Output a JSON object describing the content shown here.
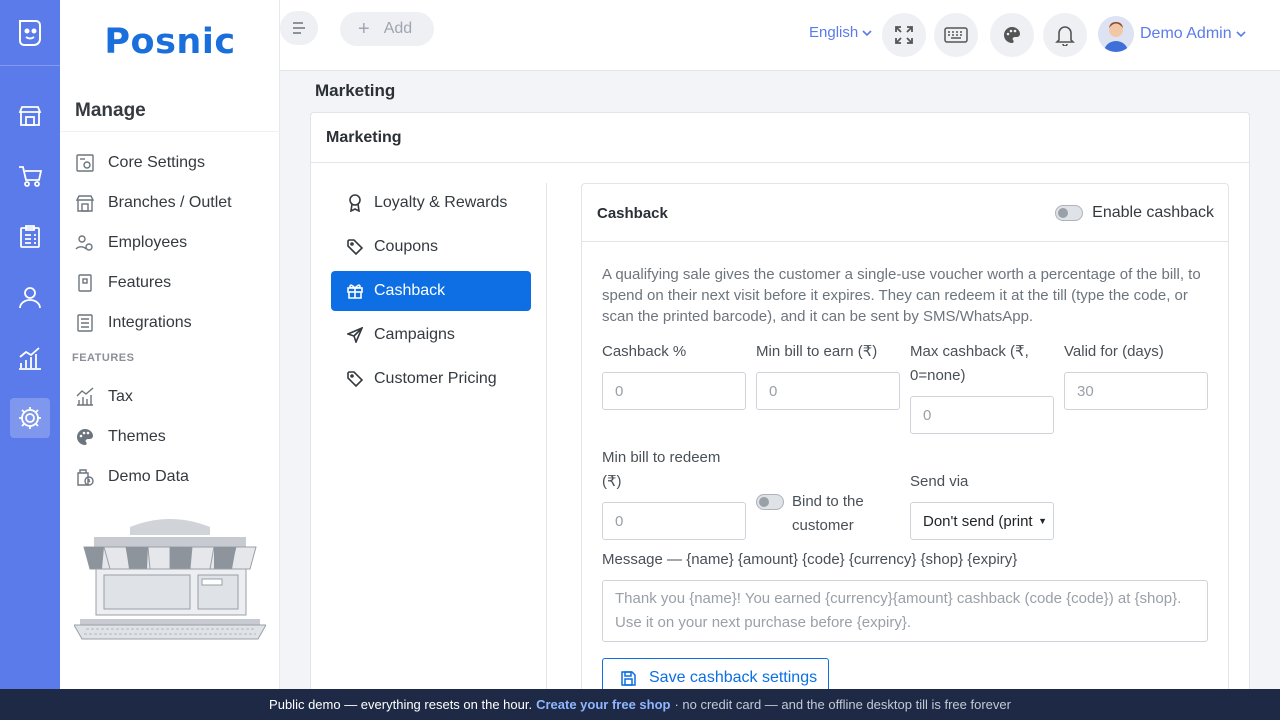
{
  "brand": {
    "name": "Posnic"
  },
  "menu": {
    "title": "Manage",
    "items": [
      {
        "label": "Core Settings",
        "icon": "settings-doc-icon"
      },
      {
        "label": "Branches / Outlet",
        "icon": "store-icon"
      },
      {
        "label": "Employees",
        "icon": "employees-gear-icon"
      },
      {
        "label": "Features",
        "icon": "features-icon"
      },
      {
        "label": "Integrations",
        "icon": "integrations-icon"
      }
    ],
    "section_label": "FEATURES",
    "feature_items": [
      {
        "label": "Tax",
        "icon": "tax-chart-icon"
      },
      {
        "label": "Themes",
        "icon": "palette-icon"
      },
      {
        "label": "Demo Data",
        "icon": "demo-data-icon"
      }
    ]
  },
  "topbar": {
    "add_label": "Add",
    "language": "English",
    "user_name": "Demo Admin"
  },
  "page": {
    "title": "Marketing"
  },
  "card": {
    "title": "Marketing"
  },
  "subnav": [
    {
      "label": "Loyalty & Rewards",
      "icon": "award-icon",
      "active": false
    },
    {
      "label": "Coupons",
      "icon": "tag-icon",
      "active": false
    },
    {
      "label": "Cashback",
      "icon": "gift-icon",
      "active": true
    },
    {
      "label": "Campaigns",
      "icon": "send-icon",
      "active": false
    },
    {
      "label": "Customer Pricing",
      "icon": "tag-icon",
      "active": false
    }
  ],
  "cashback": {
    "title": "Cashback",
    "enable_label": "Enable cashback",
    "description": "A qualifying sale gives the customer a single-use voucher worth a percentage of the bill, to spend on their next visit before it expires. They can redeem it at the till (type the code, or scan the printed barcode), and it can be sent by SMS/WhatsApp.",
    "fields": {
      "percent": {
        "label": "Cashback %",
        "placeholder": "0"
      },
      "min_bill_earn": {
        "label": "Min bill to earn (₹)",
        "placeholder": "0"
      },
      "max_cashback_line1": "Max cashback (₹,",
      "max_cashback_line2": "0=none)",
      "max_cashback_placeholder": "0",
      "valid_for": {
        "label": "Valid for (days)",
        "placeholder": "30"
      },
      "min_bill_redeem_line1": "Min bill to redeem",
      "min_bill_redeem_line2": "(₹)",
      "min_bill_redeem_placeholder": "0",
      "bind_line1": "Bind to the",
      "bind_line2": "customer",
      "send_via": {
        "label": "Send via",
        "value": "Don't send (print"
      },
      "message": {
        "label": "Message — {name} {amount} {code} {currency} {shop} {expiry}",
        "placeholder": "Thank you {name}! You earned {currency}{amount} cashback (code {code}) at {shop}. Use it on your next purchase before {expiry}."
      }
    },
    "save_label": "Save cashback settings"
  },
  "footer": {
    "text": "Public demo — everything resets on the hour.",
    "link": "Create your free shop",
    "suffix": "· no credit card — and the offline desktop till is free forever"
  },
  "colors": {
    "rail": "#5b7bea",
    "primary": "#0d6fe3",
    "brand": "#1a6fdc",
    "footer": "#1e2a45"
  }
}
